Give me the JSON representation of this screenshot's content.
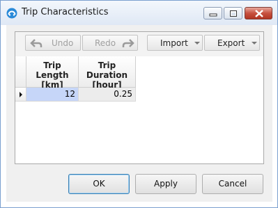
{
  "window": {
    "title": "Trip Characteristics"
  },
  "toolbar": {
    "undo_label": "Undo",
    "redo_label": "Redo",
    "import_label": "Import",
    "export_label": "Export"
  },
  "table": {
    "columns": [
      "Trip Length\n[km]",
      "Trip Duration\n[hour]"
    ],
    "col1_line1": "Trip Length",
    "col1_line2": "[km]",
    "col2_line1": "Trip Duration",
    "col2_line2": "[hour]",
    "rows": [
      {
        "trip_length": "12",
        "trip_duration": "0.25"
      }
    ]
  },
  "buttons": {
    "ok": "OK",
    "apply": "Apply",
    "cancel": "Cancel"
  },
  "colors": {
    "selected_cell": "#c6d6f8",
    "title_bar": "#dfe8f5",
    "close_button": "#c7513f"
  }
}
